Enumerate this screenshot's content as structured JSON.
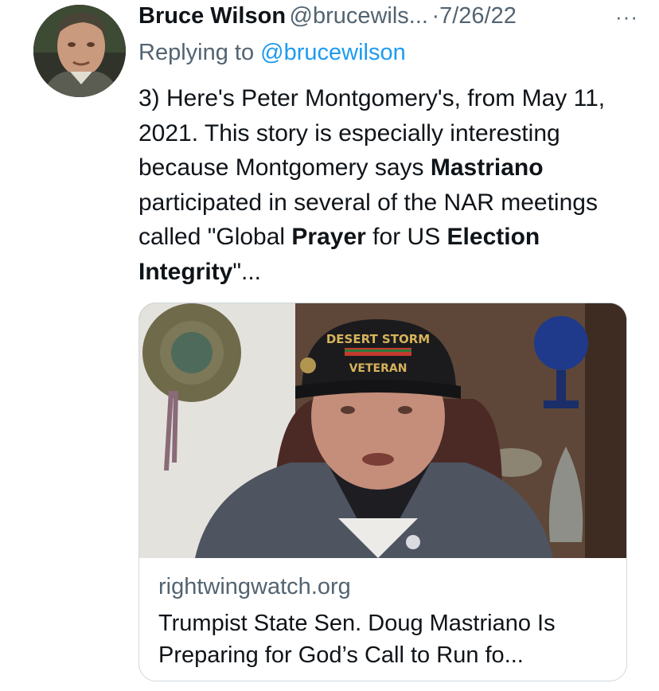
{
  "tweet": {
    "author_name": "Bruce Wilson",
    "author_handle": "@brucewils...",
    "separator": "·",
    "date": "7/26/22",
    "more_label": "···",
    "reply_prefix": "Replying to",
    "reply_mention": "@brucewilson",
    "text": {
      "part1": "3) Here's Peter Montgomery's, from May 11, 2021. This story is especially interesting because Montgomery says ",
      "bold1": "Mastriano",
      "part2": " participated in several of the NAR meetings called \"Global ",
      "bold2": "Prayer",
      "part3": " for US ",
      "bold3": "Election Integrity",
      "part4": "\"..."
    }
  },
  "card": {
    "image_alt": "Man in Desert Storm Veteran cap seated in leather chair",
    "cap_text_top": "DESERT STORM",
    "cap_text_bottom": "VETERAN",
    "domain": "rightwingwatch.org",
    "title": "Trumpist State Sen. Doug Mastriano Is Preparing for God’s Call to Run fo..."
  },
  "colors": {
    "text_primary": "#0f1419",
    "text_secondary": "#536471",
    "link_blue": "#1d9bf0",
    "border": "#cfd9de"
  }
}
